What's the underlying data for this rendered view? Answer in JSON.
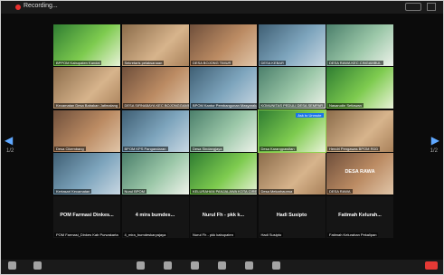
{
  "header": {
    "recording_label": "Recording..."
  },
  "pager": {
    "left_page": "1/2",
    "right_page": "1/2"
  },
  "tiles": [
    {
      "name": "BPPOM Kabupaten Kandal"
    },
    {
      "name": "Sekretaris pelaksanaan"
    },
    {
      "name": "DESA BOJONG TIMUR"
    },
    {
      "name": "DESA KEBAR"
    },
    {
      "name": "DESA RAWA KEC.CINGAMBUL"
    },
    {
      "name": "Kecamatan Desa Babakan Jatimalang"
    },
    {
      "name": "DESA SIRNABAYA KEC BOJONGGAMBIR"
    },
    {
      "name": "BPOM Kantor Pembangunan Masyarakat"
    },
    {
      "name": "KOMUNITAS PEDULI DESA SEMPAR"
    },
    {
      "name": "Nasarudin Setiawan"
    },
    {
      "name": "Desa Cikembang"
    },
    {
      "name": "BPOM KPS Pangandaran"
    },
    {
      "name": "Desa Sindangjaya"
    },
    {
      "name": "Desa Karangpawitan"
    },
    {
      "name": "Hendri Pengawas BPOM RDD"
    },
    {
      "name": "Kertasari Kecamatan",
      "title": ""
    },
    {
      "name": "Nurul BPOM"
    },
    {
      "name": "KELURAHAN PANJALAWA KOTA CIREBON"
    },
    {
      "name": "Desa Mekarhaurwa"
    },
    {
      "name": "DESA RAWA",
      "title": "DESA RAWA"
    },
    {
      "name": "POM Farmasi_Dinkes Kab Purwakarta",
      "title": "POM Farmasi  Dinkes..."
    },
    {
      "name": "4_mira_bumdeskaryajaya",
      "title": "4 mira bumdes..."
    },
    {
      "name": "Nurul Fh - pkk kabupaten",
      "title": "Nurul Fh - pkk k..."
    },
    {
      "name": "Hadi Susipto",
      "title": "Hadi Susipto"
    },
    {
      "name": "Fatimah Kelurahan Pekalipan",
      "title": "Fatimah Kelurah..."
    }
  ],
  "active_badge": "Ask to Unmute",
  "colors": {
    "accent": "#8fd14f",
    "rec": "#e8312f",
    "end": "#e53935"
  }
}
